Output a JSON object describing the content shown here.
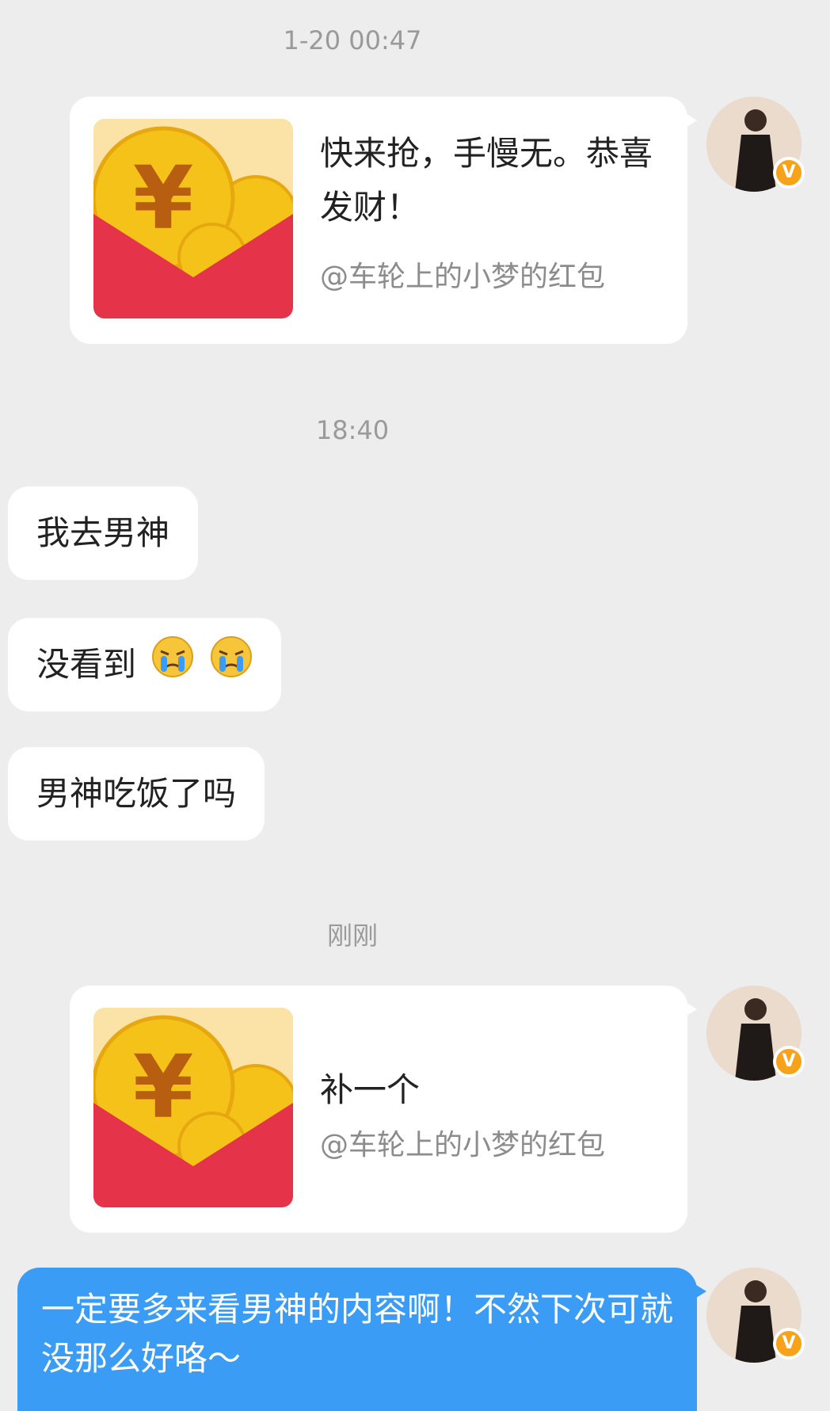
{
  "timestamps": [
    "1-20 00:47",
    "18:40",
    "刚刚"
  ],
  "red_packet_1": {
    "title": "快来抢，手慢无。恭喜发财！",
    "sender": "@车轮上的小梦的红包"
  },
  "messages_left": [
    {
      "text": "我去男神"
    },
    {
      "text": "没看到",
      "emoji": "crying-face"
    },
    {
      "text": "男神吃饭了吗"
    }
  ],
  "red_packet_2": {
    "title": "补一个",
    "sender": "@车轮上的小梦的红包"
  },
  "reply": {
    "text": "一定要多来看男神的内容啊！不然下次可就没那么好咯～"
  },
  "colors": {
    "background": "#ededed",
    "bubble": "#ffffff",
    "reply_bubble": "#3b9cf5",
    "envelope_red": "#e5334a",
    "coin_gold": "#f5c21a",
    "verified_badge": "#f7a21b"
  }
}
